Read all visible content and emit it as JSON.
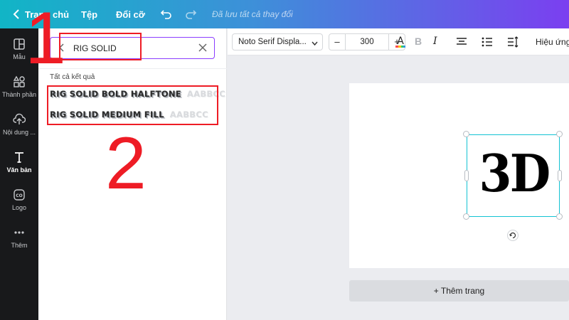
{
  "topbar": {
    "home_label": "Trang chủ",
    "file_menu": "Tệp",
    "resize_menu": "Đổi cỡ",
    "saved_status": "Đã lưu tất cả thay đổi"
  },
  "rail": {
    "items": [
      {
        "label": "Mẫu",
        "icon": "template-icon"
      },
      {
        "label": "Thành phần",
        "icon": "elements-icon"
      },
      {
        "label": "Nội dung ...",
        "icon": "upload-icon"
      },
      {
        "label": "Văn bản",
        "icon": "text-icon"
      },
      {
        "label": "Logo",
        "icon": "logo-icon"
      },
      {
        "label": "Thêm",
        "icon": "more-icon"
      }
    ]
  },
  "search": {
    "value": "RIG SOLID"
  },
  "results": {
    "heading": "Tất cả kết quả",
    "fonts": [
      {
        "name": "RIG SOLID BOLD HALFTONE",
        "sample": "AABBCC"
      },
      {
        "name": "RIG SOLID MEDIUM FILL",
        "sample": "AABBCC"
      }
    ]
  },
  "toolbar": {
    "font_name": "Noto Serif Displa...",
    "font_size": "300",
    "bold": "B",
    "italic": "I",
    "effects": "Hiệu ứng"
  },
  "canvas": {
    "text": "3D",
    "add_page": "+ Thêm trang"
  },
  "annotations": {
    "step1": "1",
    "step2": "2",
    "color": "#ee1c25"
  },
  "colors": {
    "accent": "#8b3dff",
    "selection": "#13c3d3",
    "rail_bg": "#18191b"
  }
}
